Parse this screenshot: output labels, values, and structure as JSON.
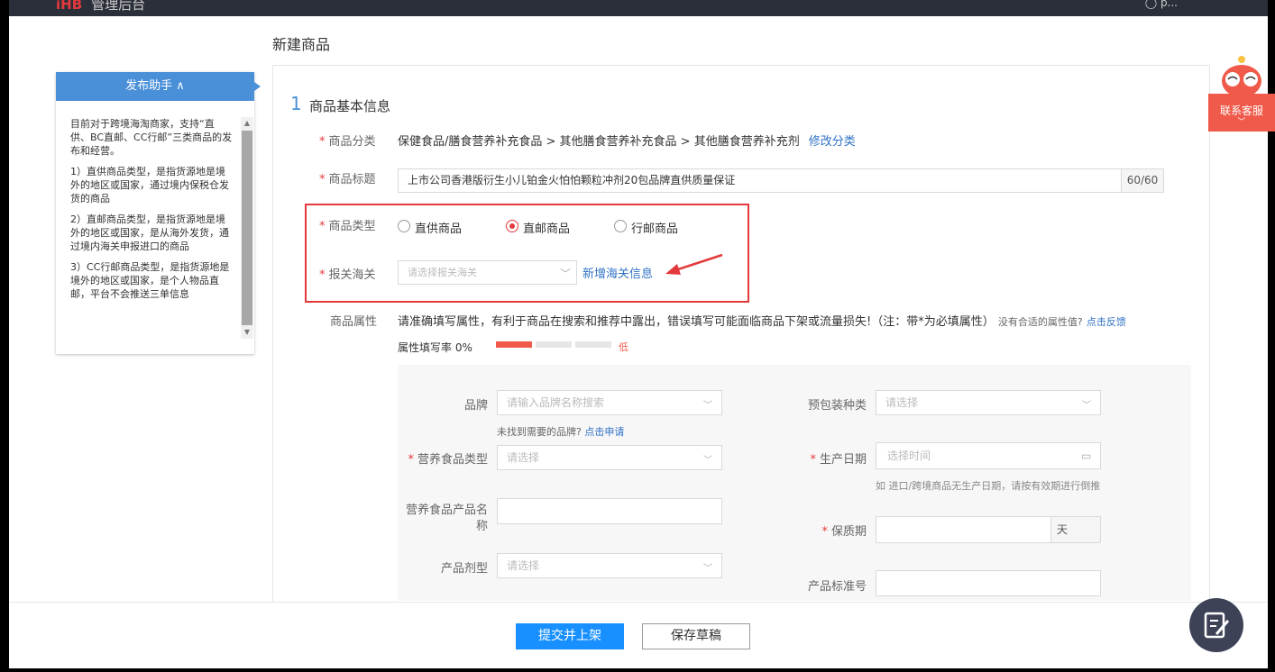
{
  "topbar": {
    "brand": "iHB",
    "brand_sub": "管理后台",
    "user": "p..."
  },
  "page_title": "新建商品",
  "helper": {
    "title": "发布助手 ∧",
    "paragraphs": [
      "目前对于跨境海淘商家，支持“直供、BC直邮、CC行邮”三类商品的发布和经营。",
      "1）直供商品类型，是指货源地是境外的地区或国家，通过境内保税仓发货的商品",
      "2）直邮商品类型，是指货源地是境外的地区或国家，是从海外发货，通过境内海关申报进口的商品",
      "3）CC行邮商品类型，是指货源地是境外的地区或国家，是个人物品直邮，平台不会推送三单信息"
    ]
  },
  "section": {
    "num": "1",
    "title": "商品基本信息"
  },
  "form": {
    "category": {
      "label": "商品分类",
      "value": "保健食品/膳食营养补充食品 > 其他膳食营养补充食品 > 其他膳食营养补充剂",
      "link": "修改分类"
    },
    "title": {
      "label": "商品标题",
      "value": "上市公司香港版衍生小儿铂金火怕怕颗粒冲剂20包品牌直供质量保证",
      "count": "60/60"
    },
    "type": {
      "label": "商品类型",
      "options": [
        "直供商品",
        "直邮商品",
        "行邮商品"
      ],
      "selected": "直邮商品"
    },
    "customs": {
      "label": "报关海关",
      "placeholder": "请选择报关海关",
      "link": "新增海关信息"
    },
    "attrs": {
      "label": "商品属性",
      "hint": "请准确填写属性，有利于商品在搜索和推荐中露出，错误填写可能面临商品下架或流量损失!（注：带*为必填属性）",
      "hint_small": "没有合适的属性值?",
      "feedback": "点击反馈",
      "rate_label": "属性填写率 0%",
      "rate_level": "低",
      "rate_value": 0
    }
  },
  "attr_fields": {
    "brand": {
      "label": "品牌",
      "placeholder": "请输入品牌名称搜索",
      "note": "未找到需要的品牌?",
      "note_link": "点击申请"
    },
    "pack": {
      "label": "预包装种类",
      "placeholder": "请选择"
    },
    "nutri_type": {
      "label": "营养食品类型",
      "placeholder": "请选择"
    },
    "prod_date": {
      "label": "生产日期",
      "placeholder": "选择时间",
      "note": "如 进口/跨境商品无生产日期，请按有效期进行倒推"
    },
    "nutri_name": {
      "label": "营养食品产品名称"
    },
    "shelf": {
      "label": "保质期",
      "unit": "天"
    },
    "dosage": {
      "label": "产品剂型",
      "placeholder": "请选择"
    },
    "standard": {
      "label": "产品标准号"
    }
  },
  "buttons": {
    "submit": "提交并上架",
    "draft": "保存草稿"
  },
  "service": {
    "label": "联系客服"
  },
  "colors": {
    "accent": "#e4393c",
    "primary": "#1890ff",
    "link": "#2f72c4"
  }
}
